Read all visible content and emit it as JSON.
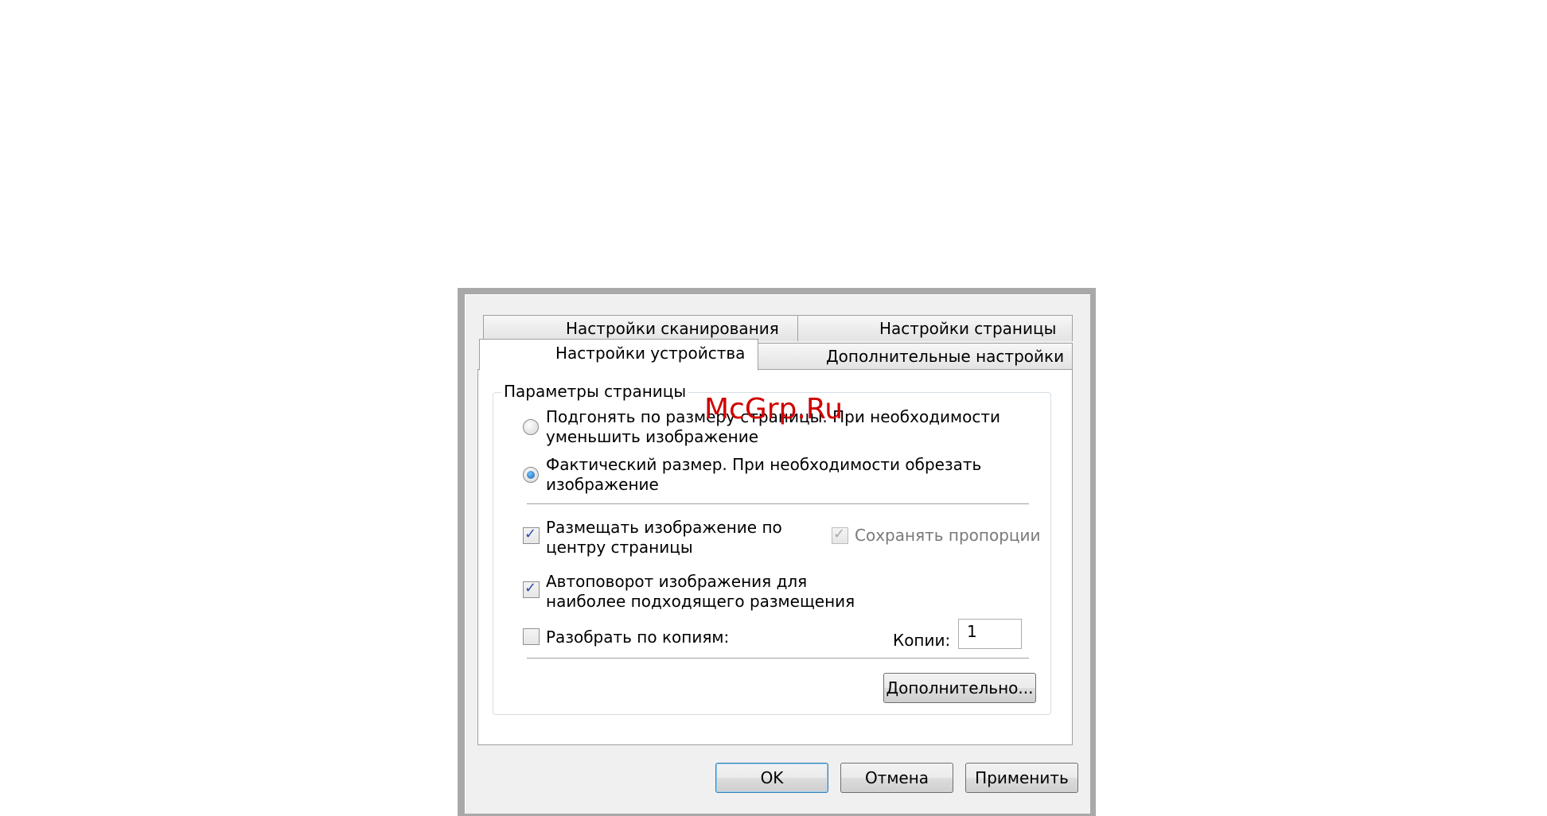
{
  "tabs": {
    "back_row": [
      "Настройки сканирования",
      "Настройки страницы"
    ],
    "front_row": [
      "Настройки устройства",
      "Дополнительные настройки"
    ]
  },
  "group": {
    "legend": "Параметры страницы",
    "radio_fit": {
      "line1": "Подгонять по размеру страницы. При необходимости",
      "line2": "уменьшить изображение",
      "checked": false
    },
    "radio_actual": {
      "line1": "Фактический размер. При необходимости обрезать",
      "line2": "изображение",
      "checked": true
    },
    "chk_center": {
      "line1": "Размещать изображение по",
      "line2": "центру страницы",
      "checked": true
    },
    "chk_keep_ratio": {
      "label": "Сохранять пропорции",
      "checked": true,
      "enabled": false
    },
    "chk_autorotate": {
      "line1": "Автоповорот изображения для",
      "line2": "наиболее подходящего размещения",
      "checked": true
    },
    "chk_collate": {
      "label": "Разобрать по копиям:",
      "checked": false
    },
    "copies_label": "Копии:",
    "copies_value": "1",
    "advanced_button": "Дополнительно..."
  },
  "buttons": {
    "ok": "OK",
    "cancel": "Отмена",
    "apply": "Применить"
  },
  "watermark": "McGrp.Ru"
}
